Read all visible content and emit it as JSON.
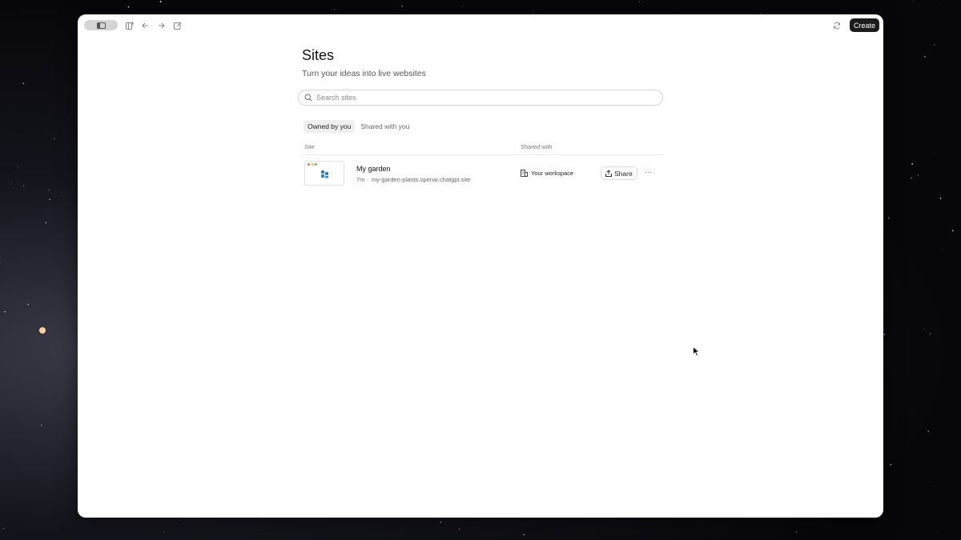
{
  "toolbar": {
    "create_label": "Create"
  },
  "page": {
    "title": "Sites",
    "subtitle": "Turn your ideas into live websites"
  },
  "search": {
    "placeholder": "Search sites"
  },
  "tabs": [
    {
      "label": "Owned by you",
      "active": true
    },
    {
      "label": "Shared with you",
      "active": false
    }
  ],
  "table": {
    "columns": [
      "Site",
      "Shared with"
    ],
    "rows": [
      {
        "name": "My garden",
        "age": "7m",
        "separator": "·",
        "domain": "my-garden-plants.openai.chatgpt.site",
        "shared_with": "Your workspace",
        "share_label": "Share",
        "more_label": "···"
      }
    ]
  },
  "icons": {
    "sidebar": "sidebar-toggle-icon",
    "new_window": "new-window-icon",
    "back": "arrow-left-icon",
    "forward": "arrow-right-icon",
    "compose": "compose-icon",
    "refresh": "refresh-icon",
    "search": "search-icon",
    "workspace": "building-icon",
    "share": "share-upload-icon"
  },
  "colors": {
    "accent": "#1c1c1c",
    "thumb_icon": "#2f7fd6",
    "dot_red": "#ec6a5e",
    "dot_yellow": "#f4bf4f",
    "dot_green": "#61c554"
  }
}
